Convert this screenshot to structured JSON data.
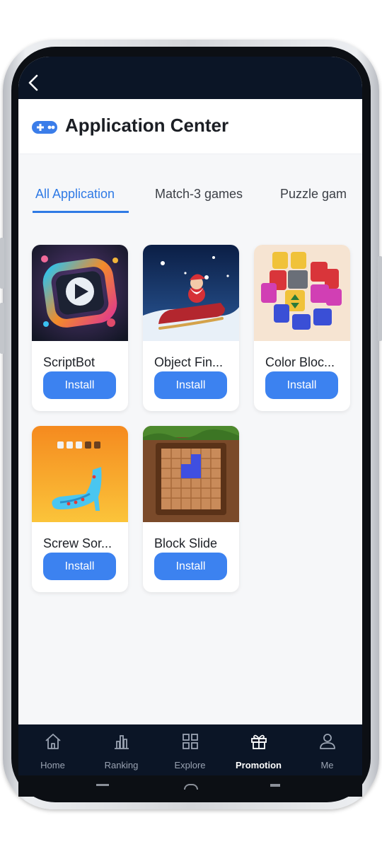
{
  "header": {
    "title": "Application Center"
  },
  "tabs": [
    {
      "label": "All Application",
      "active": true
    },
    {
      "label": "Match-3 games",
      "active": false
    },
    {
      "label": "Puzzle gam",
      "active": false
    }
  ],
  "apps": [
    {
      "name": "ScriptBot",
      "install_label": "Install"
    },
    {
      "name": "Object Fin...",
      "install_label": "Install"
    },
    {
      "name": "Color Bloc...",
      "install_label": "Install"
    },
    {
      "name": "Screw Sor...",
      "install_label": "Install"
    },
    {
      "name": "Block Slide",
      "install_label": "Install"
    }
  ],
  "bottom_nav": [
    {
      "label": "Home",
      "icon": "home-icon"
    },
    {
      "label": "Ranking",
      "icon": "ranking-icon"
    },
    {
      "label": "Explore",
      "icon": "grid-icon"
    },
    {
      "label": "Promotion",
      "icon": "gift-icon",
      "active": true
    },
    {
      "label": "Me",
      "icon": "user-icon"
    }
  ],
  "colors": {
    "accent": "#2f7ae5",
    "button": "#3c82f0",
    "nav_bg": "#0b1526"
  }
}
